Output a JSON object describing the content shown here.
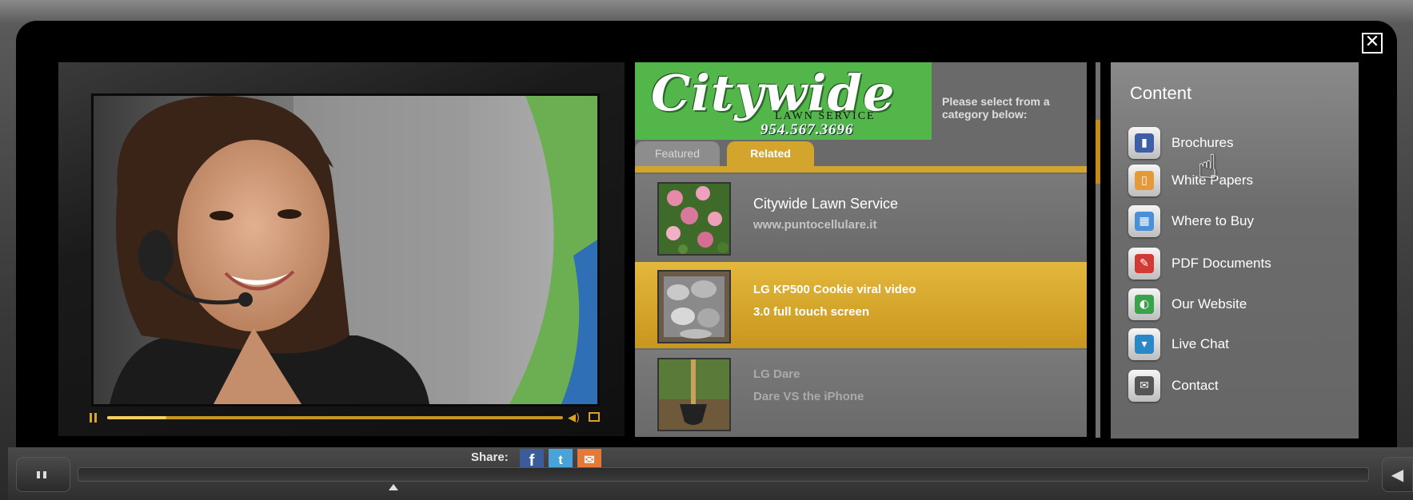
{
  "modal": {
    "close_glyph": "✕"
  },
  "video": {
    "progress": 0.13,
    "controls": {
      "pause_icon": "pause-icon",
      "volume_icon": "volume-icon",
      "fullscreen_icon": "fullscreen-icon"
    },
    "accent_color": "#d9a22b"
  },
  "brand": {
    "logo_script": "Citywide",
    "logo_sub": "LAWN SERVICE",
    "logo_phone": "954.567.3696",
    "logo_color": "#53b64a"
  },
  "list": {
    "hint": "Please select from a category below:",
    "tabs": [
      {
        "label": "Featured",
        "selected": false
      },
      {
        "label": "Related",
        "selected": true
      }
    ],
    "accent_color": "#d4a52c",
    "items": [
      {
        "title": "Citywide Lawn Service",
        "subtitle": "www.puntocellulare.it",
        "state": "normal"
      },
      {
        "title": "LG KP500 Cookie viral video",
        "subtitle": "3.0 full touch screen",
        "state": "highlighted"
      },
      {
        "title": "LG Dare",
        "subtitle": "Dare VS the iPhone",
        "state": "dimmed"
      }
    ]
  },
  "content": {
    "title": "Content",
    "items": [
      {
        "label": "Brochures",
        "icon": "brochure-icon",
        "glyph": "▮",
        "color": "#3e5fa5"
      },
      {
        "label": "White Papers",
        "icon": "white-paper-icon",
        "glyph": "▯",
        "color": "#e49a3a"
      },
      {
        "label": "Where to Buy",
        "icon": "building-icon",
        "glyph": "▦",
        "color": "#4a90d6"
      },
      {
        "label": "PDF Documents",
        "icon": "pdf-icon",
        "glyph": "✎",
        "color": "#d23b35"
      },
      {
        "label": "Our Website",
        "icon": "globe-icon",
        "glyph": "◐",
        "color": "#3aa24a"
      },
      {
        "label": "Live Chat",
        "icon": "chat-bubble-icon",
        "glyph": "▾",
        "color": "#2a87c8"
      },
      {
        "label": "Contact",
        "icon": "envelope-icon",
        "glyph": "✉",
        "color": "#555555"
      }
    ]
  },
  "share": {
    "label": "Share:",
    "buttons": [
      {
        "name": "facebook",
        "glyph": "f",
        "icon": "facebook-icon"
      },
      {
        "name": "twitter",
        "glyph": "t",
        "icon": "twitter-icon"
      },
      {
        "name": "email",
        "glyph": "✉",
        "icon": "email-icon"
      }
    ]
  },
  "player": {
    "volume_glyph": "◀"
  },
  "cursor": {
    "icon": "hand-pointer-icon",
    "glyph": "☝"
  }
}
